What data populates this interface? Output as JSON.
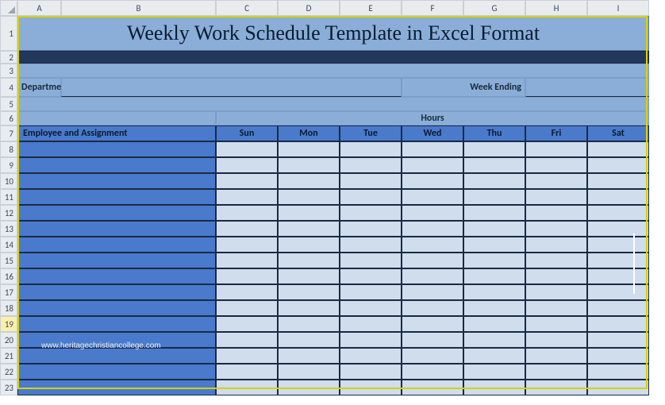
{
  "columns": [
    "A",
    "B",
    "C",
    "D",
    "E",
    "F",
    "G",
    "H",
    "I"
  ],
  "rows": [
    "1",
    "2",
    "3",
    "4",
    "5",
    "6",
    "7",
    "8",
    "9",
    "10",
    "11",
    "12",
    "13",
    "14",
    "15",
    "16",
    "17",
    "18",
    "19",
    "20",
    "21",
    "22",
    "23"
  ],
  "title": "Weekly Work Schedule Template in Excel Format",
  "labels": {
    "department": "Department",
    "week_ending": "Week Ending",
    "hours": "Hours",
    "employee": "Employee and Assignment"
  },
  "days": [
    "Sun",
    "Mon",
    "Tue",
    "Wed",
    "Thu",
    "Fri",
    "Sat"
  ],
  "watermark": "www.heritagechristiancollege.com",
  "chart_data": {
    "type": "table",
    "title": "Weekly Work Schedule Template in Excel Format",
    "columns": [
      "Employee and Assignment",
      "Sun",
      "Mon",
      "Tue",
      "Wed",
      "Thu",
      "Fri",
      "Sat"
    ],
    "rows": [
      [
        "",
        "",
        "",
        "",
        "",
        "",
        "",
        ""
      ],
      [
        "",
        "",
        "",
        "",
        "",
        "",
        "",
        ""
      ],
      [
        "",
        "",
        "",
        "",
        "",
        "",
        "",
        ""
      ],
      [
        "",
        "",
        "",
        "",
        "",
        "",
        "",
        ""
      ],
      [
        "",
        "",
        "",
        "",
        "",
        "",
        "",
        ""
      ],
      [
        "",
        "",
        "",
        "",
        "",
        "",
        "",
        ""
      ],
      [
        "",
        "",
        "",
        "",
        "",
        "",
        "",
        ""
      ],
      [
        "",
        "",
        "",
        "",
        "",
        "",
        "",
        ""
      ],
      [
        "",
        "",
        "",
        "",
        "",
        "",
        "",
        ""
      ],
      [
        "",
        "",
        "",
        "",
        "",
        "",
        "",
        ""
      ],
      [
        "",
        "",
        "",
        "",
        "",
        "",
        "",
        ""
      ],
      [
        "",
        "",
        "",
        "",
        "",
        "",
        "",
        ""
      ],
      [
        "",
        "",
        "",
        "",
        "",
        "",
        "",
        ""
      ],
      [
        "",
        "",
        "",
        "",
        "",
        "",
        "",
        ""
      ],
      [
        "",
        "",
        "",
        "",
        "",
        "",
        "",
        ""
      ],
      [
        "",
        "",
        "",
        "",
        "",
        "",
        "",
        ""
      ]
    ],
    "meta_fields": {
      "Department": "",
      "Week Ending": ""
    }
  }
}
